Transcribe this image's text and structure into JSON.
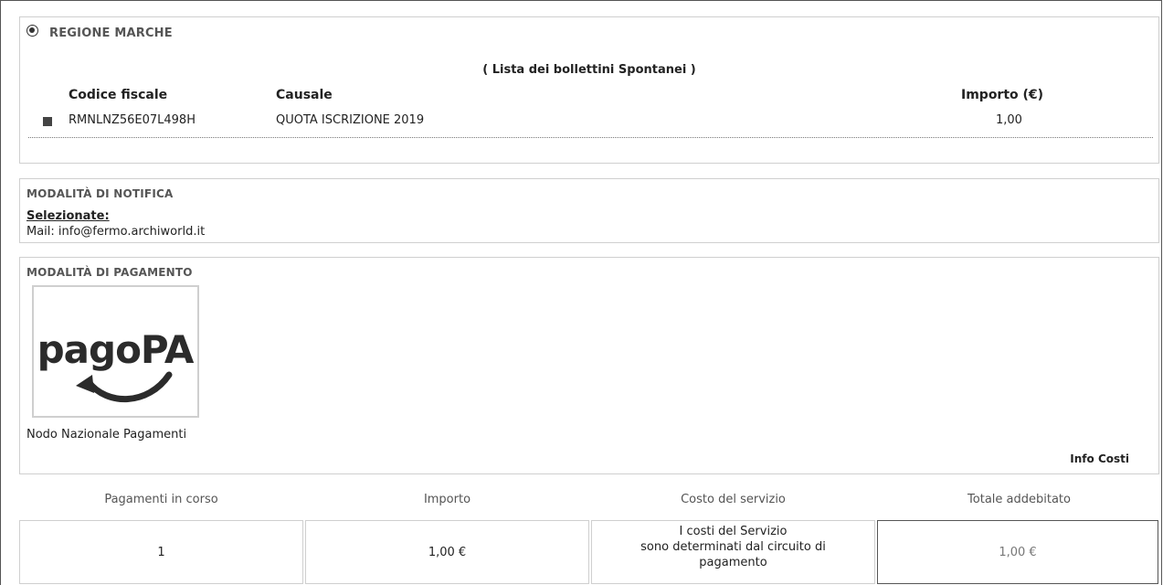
{
  "region": {
    "name": "REGIONE MARCHE"
  },
  "bulletins": {
    "title": "( Lista dei bollettini Spontanei )",
    "headers": {
      "fiscal_code": "Codice fiscale",
      "reason": "Causale",
      "amount": "Importo (€)"
    },
    "rows": [
      {
        "fiscal_code": "RMNLNZ56E07L498H",
        "reason": "QUOTA ISCRIZIONE 2019",
        "amount": "1,00"
      }
    ]
  },
  "notification": {
    "title": "MODALITÀ DI NOTIFICA",
    "selected_label": "Selezionate:",
    "mail": "Mail: info@fermo.archiworld.it"
  },
  "payment": {
    "title": "MODALITÀ DI PAGAMENTO",
    "logo_text": "pagoPA",
    "method_label": "Nodo Nazionale Pagamenti",
    "info_costs": "Info Costi"
  },
  "summary": {
    "headers": [
      "Pagamenti in corso",
      "Importo",
      "Costo del servizio",
      "Totale addebitato"
    ],
    "values": {
      "count": "1",
      "amount": "1,00 €",
      "cost_line1": "I costi del Servizio",
      "cost_line2": "sono determinati dal circuito di",
      "cost_line3": "pagamento",
      "total": "1,00 €"
    }
  },
  "colors": {
    "border": "#cfcfcf",
    "label_gray": "#555555",
    "text": "#222222"
  },
  "icons": [
    "radio-selected-icon",
    "bullet-square-icon",
    "pagopa-logo"
  ]
}
